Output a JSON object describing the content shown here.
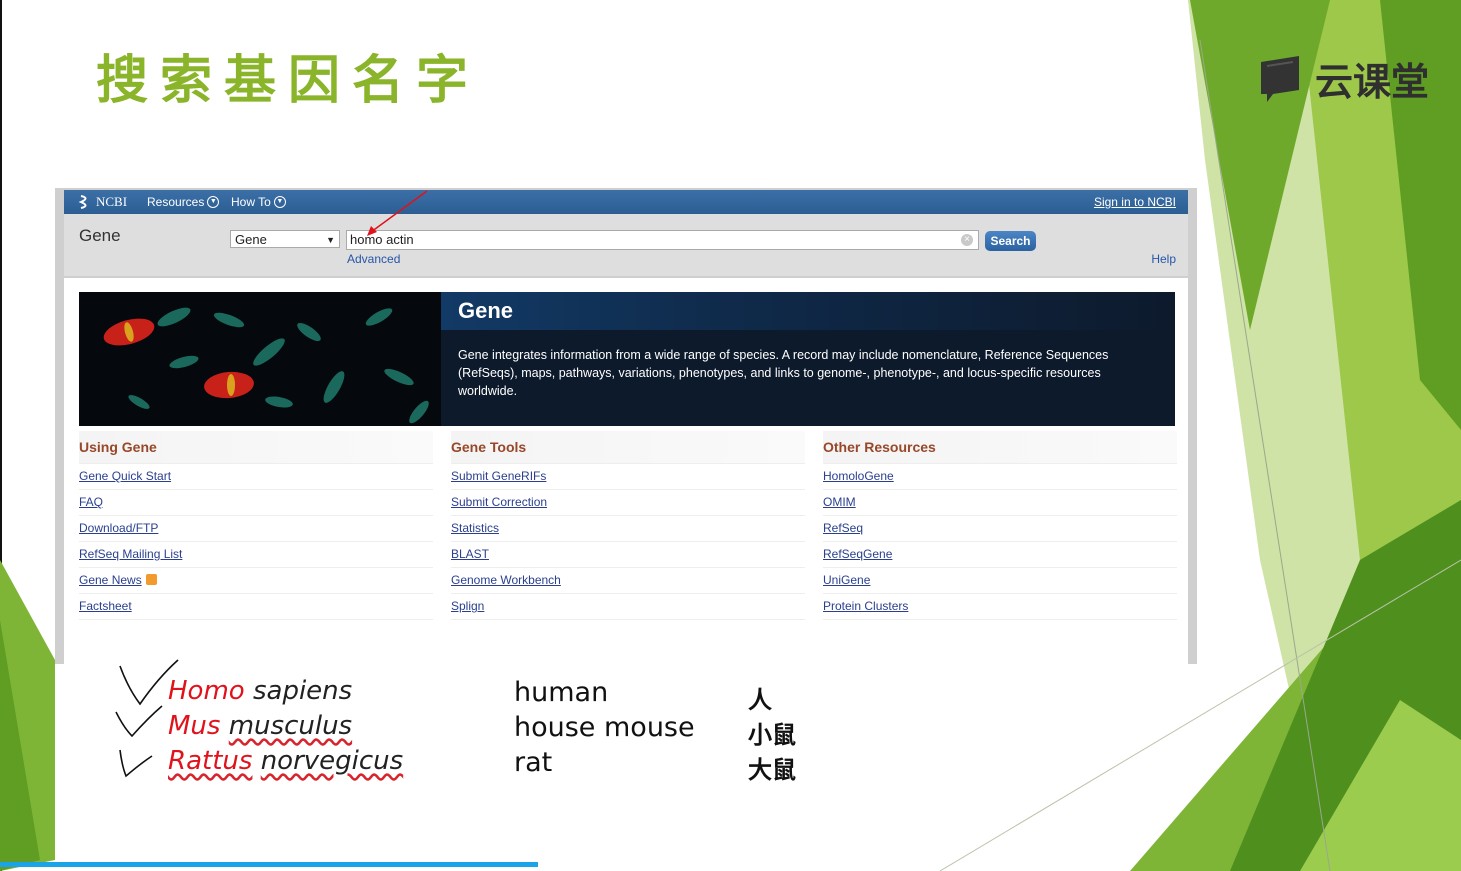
{
  "slide": {
    "title": "搜索基因名字",
    "brand": "云课堂",
    "progress_fraction": 0.368
  },
  "ncbi": {
    "logo_text": "NCBI",
    "nav": [
      {
        "label": "Resources"
      },
      {
        "label": "How To"
      }
    ],
    "sign_in": "Sign in to NCBI",
    "db_label": "Gene",
    "db_select_value": "Gene",
    "search_value": "homo actin",
    "search_button": "Search",
    "advanced_link": "Advanced",
    "help_link": "Help",
    "hero": {
      "title": "Gene",
      "description": "Gene integrates information from a wide range of species. A record may include nomenclature, Reference Sequences (RefSeqs), maps, pathways, variations, phenotypes, and links to genome-, phenotype-, and locus-specific resources worldwide."
    },
    "columns": [
      {
        "heading": "Using Gene",
        "links": [
          "Gene Quick Start",
          "FAQ",
          "Download/FTP",
          "RefSeq Mailing List",
          "Gene News",
          "Factsheet"
        ]
      },
      {
        "heading": "Gene Tools",
        "links": [
          "Submit GeneRIFs",
          "Submit Correction",
          "Statistics",
          "BLAST",
          "Genome Workbench",
          "Splign"
        ]
      },
      {
        "heading": "Other Resources",
        "links": [
          "HomoloGene",
          "OMIM",
          "RefSeq",
          "RefSeqGene",
          "UniGene",
          "Protein Clusters"
        ]
      }
    ]
  },
  "species": [
    {
      "genus": "Homo",
      "species": "sapiens",
      "common": "human",
      "zh": "人"
    },
    {
      "genus": "Mus",
      "species": "musculus",
      "common": "house mouse",
      "zh": "小鼠"
    },
    {
      "genus": "Rattus",
      "species": "norvegicus",
      "common": "rat",
      "zh": "大鼠"
    }
  ],
  "colors": {
    "title_green": "#8ab52a",
    "ncbi_blue": "#2c5e93",
    "genus_red": "#e0121b",
    "progress_blue": "#1aa3e8"
  }
}
